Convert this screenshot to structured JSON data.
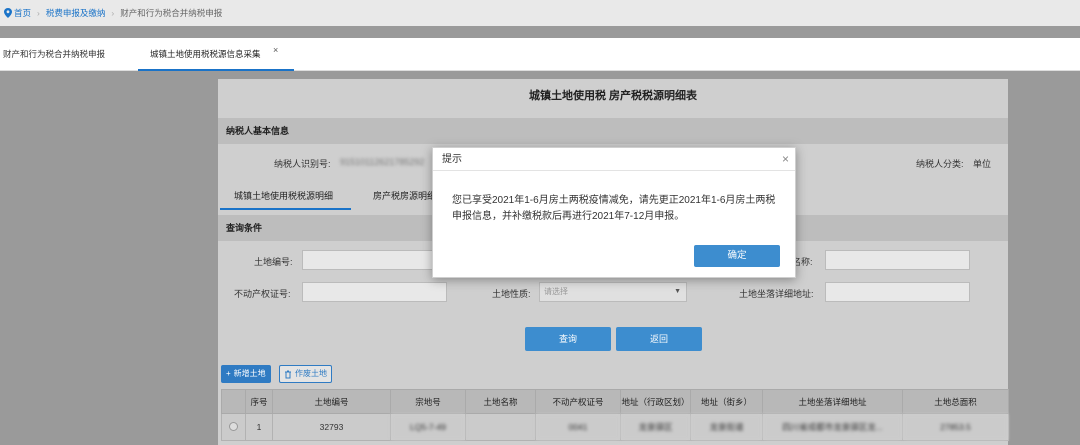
{
  "breadcrumb": {
    "home": "首页",
    "level1": "税费申报及缴纳",
    "level2": "财产和行为税合并纳税申报"
  },
  "tabs": [
    {
      "label": "财产和行为税合并纳税申报"
    },
    {
      "label": "城镇土地使用税税源信息采集",
      "close": "×"
    }
  ],
  "form": {
    "title": "城镇土地使用税 房产税税源明细表",
    "basic_section": "纳税人基本信息",
    "taxpayer_id_label": "纳税人识别号:",
    "taxpayer_id_value": "91510112621785292",
    "taxpayer_category_label": "纳税人分类:",
    "taxpayer_category_value": "单位",
    "subtabs": [
      "城镇土地使用税税源明细",
      "房产税房源明细"
    ],
    "query_section": "查询条件",
    "land_no_label": "土地编号:",
    "land_name_label": "名称:",
    "realty_cert_label": "不动产权证号:",
    "land_nature_label": "土地性质:",
    "land_nature_placeholder": "请选择",
    "land_address_label": "土地坐落详细地址:",
    "query_button": "查询",
    "back_button": "返回",
    "add_land_button": "新增土地",
    "void_land_button": "作废土地"
  },
  "table": {
    "headers": [
      "",
      "序号",
      "土地编号",
      "宗地号",
      "土地名称",
      "不动产权证号",
      "地址（行政区划）",
      "地址（街乡）",
      "土地坐落详细地址",
      "土地总面积"
    ],
    "rows": [
      [
        "",
        "1",
        "32793",
        "LQ5-7-49",
        "",
        "0041",
        "龙泉驿区",
        "龙泉街道",
        "四川省成都市龙泉驿区龙...",
        "27853.5"
      ]
    ]
  },
  "dialog": {
    "title": "提示",
    "close": "×",
    "message": "您已享受2021年1-6月房土两税疫情减免，请先更正2021年1-6月房土两税申报信息，并补缴税款后再进行2021年7-12月申报。",
    "ok_button": "确定"
  },
  "colors": {
    "accent": "#1a73c8",
    "button": "#3d8dcf"
  }
}
